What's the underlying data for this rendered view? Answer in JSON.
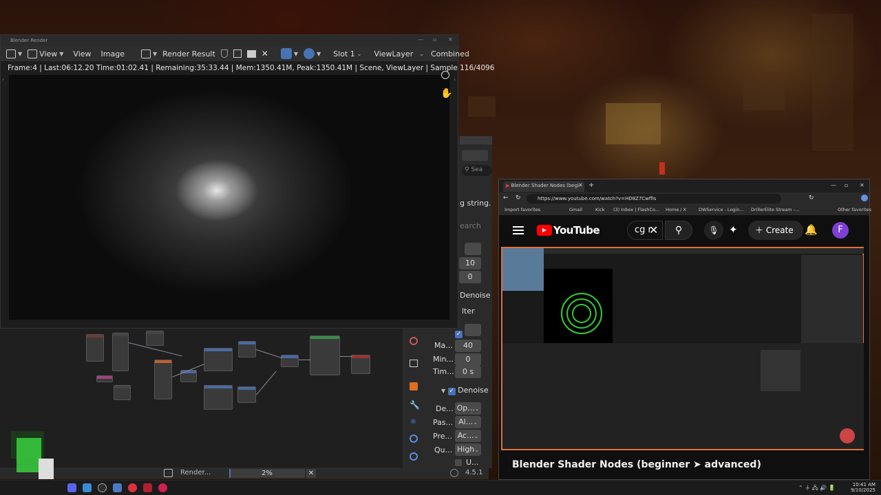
{
  "render_window": {
    "title": "Blender Render",
    "toolbar": {
      "view_menu": "View",
      "view_menu2": "View",
      "image_menu": "Image",
      "image_name": "Render Result",
      "slot": "Slot 1",
      "view_layer": "ViewLayer",
      "pass": "Combined"
    },
    "status": "Frame:4 | Last:06:12.20 Time:01:02.41 | Remaining:35:33.44 | Mem:1350.41M, Peak:1350.41M | Scene, ViewLayer | Sample 116/4096"
  },
  "properties": {
    "search_placeholder": "Sea",
    "string_tip": "g string.",
    "search2": "earch",
    "val_10": "10",
    "val_0": "0",
    "denoise_top": "Denoise",
    "filter_frag": "lter",
    "max_label": "Ma...",
    "max_val": "40",
    "min_label": "Min...",
    "min_val": "0",
    "time_label": "Tim...",
    "time_val": "0 s",
    "denoise": "Denoise",
    "denoiser_label": "De...",
    "denoiser_val": "Op...",
    "passes_label": "Pas...",
    "passes_val": "Al...",
    "prefilter_label": "Pre...",
    "prefilter_val": "Ac...",
    "quality_label": "Qu...",
    "quality_val": "High",
    "use_label": "U..."
  },
  "blender_status": {
    "job": "Render...",
    "progress_text": "2%",
    "progress": 0.02,
    "version": "4.5.1"
  },
  "browser": {
    "tab_title": "Blender Shader Nodes (begi",
    "url": "https://www.youtube.com/watch?v=HD8Z7CwffIs",
    "favorites": [
      "Import favorites",
      "Gmail",
      "Kick",
      "(3) Inbox | FlashCo...",
      "Home / X",
      "DWService - Login...",
      "DrillerElite Stream -...",
      "Other favorites"
    ],
    "youtube": {
      "logo": "YouTube",
      "search_text": "cg r",
      "create": "Create",
      "avatar": "F",
      "video_title": "Blender Shader Nodes (beginner ➤ advanced)"
    }
  },
  "taskbar": {
    "time": "10:41 AM",
    "date": "9/10/2025"
  },
  "colors": {
    "accent_blue": "#4772b3",
    "yt_red": "#ff0000",
    "video_border": "#e0703a"
  }
}
